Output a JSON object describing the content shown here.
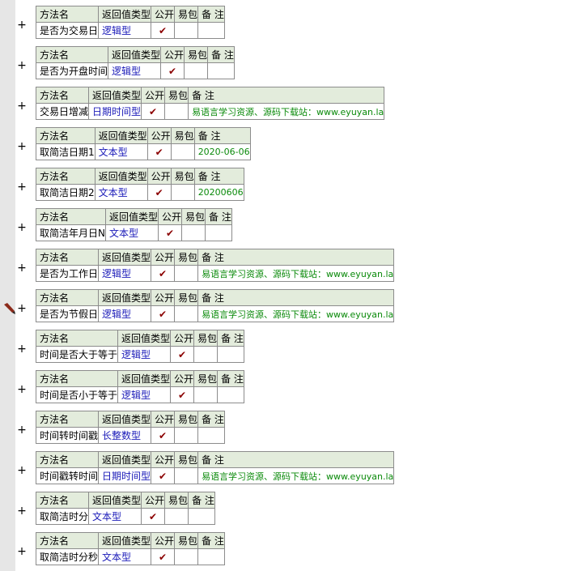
{
  "headers": {
    "method": "方法名",
    "return_type": "返回值类型",
    "public": "公开",
    "easy_pkg": "易包",
    "note": "备 注"
  },
  "expand_symbol": "+",
  "check_symbol": "✔",
  "colors": {
    "header_bg": "#e3ecdc",
    "border": "#8c8c8c",
    "type_text": "#1a1ab8",
    "note_text": "#0a8a0a",
    "check": "#8b0000",
    "gutter": "#e6e6e6"
  },
  "methods": [
    {
      "name": "是否为交易日",
      "type": "逻辑型",
      "public": true,
      "note": ""
    },
    {
      "name": "是否为开盘时间",
      "type": "逻辑型",
      "public": true,
      "note": ""
    },
    {
      "name": "交易日增减",
      "type": "日期时间型",
      "public": true,
      "note": "易语言学习资源、源码下载站：www.eyuyan.la"
    },
    {
      "name": "取简洁日期1",
      "type": "文本型",
      "public": true,
      "note": "2020-06-06"
    },
    {
      "name": "取简洁日期2",
      "type": "文本型",
      "public": true,
      "note": "20200606"
    },
    {
      "name": "取简洁年月日N",
      "type": "文本型",
      "public": true,
      "note": ""
    },
    {
      "name": "是否为工作日",
      "type": "逻辑型",
      "public": true,
      "note": "易语言学习资源、源码下载站：www.eyuyan.la"
    },
    {
      "name": "是否为节假日",
      "type": "逻辑型",
      "public": true,
      "note": "易语言学习资源、源码下载站：www.eyuyan.la"
    },
    {
      "name": "时间是否大于等于",
      "type": "逻辑型",
      "public": true,
      "note": ""
    },
    {
      "name": "时间是否小于等于",
      "type": "逻辑型",
      "public": true,
      "note": ""
    },
    {
      "name": "时间转时间戳",
      "type": "长整数型",
      "public": true,
      "note": ""
    },
    {
      "name": "时间戳转时间",
      "type": "日期时间型",
      "public": true,
      "note": "易语言学习资源、源码下载站：www.eyuyan.la"
    },
    {
      "name": "取简洁时分",
      "type": "文本型",
      "public": true,
      "note": ""
    },
    {
      "name": "取简洁时分秒",
      "type": "文本型",
      "public": true,
      "note": ""
    }
  ]
}
